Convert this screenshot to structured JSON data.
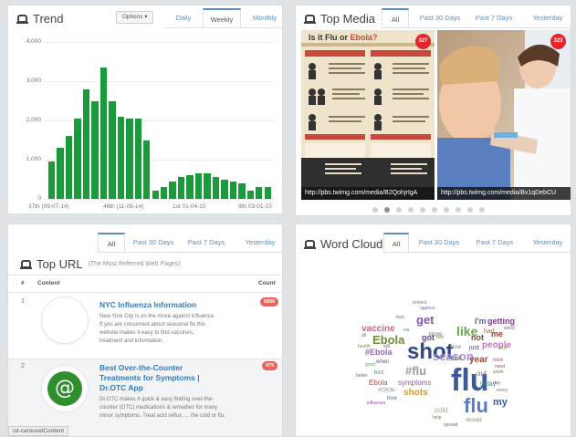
{
  "trend": {
    "title": "Trend",
    "options_label": "Options ▾",
    "tabs": [
      "Daily",
      "Weekly",
      "Monthly"
    ],
    "active_tab": "Weekly",
    "chart_data": {
      "type": "bar",
      "ylim": [
        0,
        4000
      ],
      "yticks": [
        "4,000",
        "3,000",
        "2,000",
        "1,000",
        "0"
      ],
      "xticks": [
        "37th (09-07-14)",
        "46th (11-09-14)",
        "1st 01-04-15",
        "9th 03-01-15"
      ],
      "values": [
        950,
        1300,
        1600,
        2050,
        2800,
        2500,
        3350,
        2500,
        2100,
        2050,
        2050,
        1500,
        200,
        300,
        450,
        550,
        600,
        650,
        650,
        550,
        500,
        450,
        400,
        200,
        300,
        300
      ],
      "color": "#1a9a3a"
    }
  },
  "top_media": {
    "title": "Top Media",
    "tabs": [
      "All",
      "Past 30 Days",
      "Past 7 Days",
      "Yesterday"
    ],
    "active_tab": "All",
    "items": [
      {
        "caption": "http://pbs.twimg.com/media/B2QohjrIgA",
        "count": "327",
        "headline_a": "Is it Flu or ",
        "headline_b": "Ebola?"
      },
      {
        "caption": "http://pbs.twimg.com/media/Bx1qDebCU",
        "count": "323"
      }
    ],
    "dots": 10,
    "active_dot": 1
  },
  "top_url": {
    "title": "Top URL",
    "subtitle": "(The Most Referred Web Pages)",
    "tabs": [
      "All",
      "Past 30 Days",
      "Past 7 Days",
      "Yesterday"
    ],
    "active_tab": "All",
    "columns": [
      "#",
      "Content",
      "Count"
    ],
    "rows": [
      {
        "num": "1",
        "title": "NYC Influenza Information",
        "desc": "New York City is on the move against influenza. If you are concerned about seasonal flu this website makes it easy to find vaccines, treatment and information.",
        "count": "5856",
        "logo": "",
        "logo_color": "#ffffff"
      },
      {
        "num": "2",
        "title": "Best Over-the-Counter Treatments for Symptoms | Dr.OTC App",
        "desc": "Dr.OTC makes it quick & easy finding over-the-counter (OTC) medications & remedies for many minor symptoms. Treat acid reflux, ... the cold or flu.",
        "count": "979",
        "logo": "@",
        "logo_color": "#2f8f2f"
      }
    ],
    "status_text": "ist-carouselContent"
  },
  "word_cloud": {
    "title": "Word Cloud",
    "tabs": [
      "All",
      "Past 30 Days",
      "Past 7 Days",
      "Yesterday"
    ],
    "active_tab": "All",
    "words": [
      {
        "text": "flu",
        "size": 34,
        "color": "#3b5a9a"
      },
      {
        "text": "shot",
        "size": 24,
        "color": "#2e4a86"
      },
      {
        "text": "flu",
        "size": 22,
        "color": "#5a7cc0"
      },
      {
        "text": "like",
        "size": 14,
        "color": "#6aa84f"
      },
      {
        "text": "season",
        "size": 13,
        "color": "#a98bd6"
      },
      {
        "text": "Ebola",
        "size": 13,
        "color": "#6f8a3a"
      },
      {
        "text": "#flu",
        "size": 13,
        "color": "#9b9b9b"
      },
      {
        "text": "get",
        "size": 13,
        "color": "#7a5ab0"
      },
      {
        "text": "vaccine",
        "size": 10,
        "color": "#c06a8a"
      },
      {
        "text": "shots",
        "size": 10,
        "color": "#c79a3e"
      },
      {
        "text": "people",
        "size": 10,
        "color": "#c07ab8"
      },
      {
        "text": "my",
        "size": 11,
        "color": "#3b5a9a"
      },
      {
        "text": "year",
        "size": 10,
        "color": "#9a4a3a"
      },
      {
        "text": "#Ebola",
        "size": 9,
        "color": "#8a6ab0"
      },
      {
        "text": "symptoms",
        "size": 8,
        "color": "#8a5ab0"
      },
      {
        "text": "got",
        "size": 9,
        "color": "#5a4a8a"
      },
      {
        "text": "getting",
        "size": 9,
        "color": "#7a3a8a"
      },
      {
        "text": "I'm",
        "size": 9,
        "color": "#4a6a9a"
      },
      {
        "text": "me",
        "size": 9,
        "color": "#9a3a3a"
      },
      {
        "text": "not",
        "size": 9,
        "color": "#6a4a3a"
      },
      {
        "text": "out",
        "size": 8,
        "color": "#8a6a3a"
      },
      {
        "text": "today",
        "size": 7,
        "color": "#4a8a6a"
      },
      {
        "text": "Ebola",
        "size": 8,
        "color": "#c04a4a"
      },
      {
        "text": "cold",
        "size": 8,
        "color": "#c79a6e"
      },
      {
        "text": "should",
        "size": 6,
        "color": "#8a8a4a"
      },
      {
        "text": "sick",
        "size": 7,
        "color": "#5a8a5a"
      },
      {
        "text": "know",
        "size": 6,
        "color": "#6a6a9a"
      },
      {
        "text": "had",
        "size": 7,
        "color": "#9a6a4a"
      },
      {
        "text": "just",
        "size": 7,
        "color": "#4a4a8a"
      },
      {
        "text": "time",
        "size": 6,
        "color": "#8a8a8a"
      },
      {
        "text": "when",
        "size": 6,
        "color": "#6a4a8a"
      },
      {
        "text": "bird",
        "size": 6,
        "color": "#4a8a8a"
      },
      {
        "text": "#CDCflu",
        "size": 5,
        "color": "#7a7aa0"
      },
      {
        "text": "health",
        "size": 5,
        "color": "#6a9a4a"
      },
      {
        "text": "new",
        "size": 6,
        "color": "#a05a6a"
      },
      {
        "text": "better",
        "size": 5,
        "color": "#7a6a9a"
      },
      {
        "text": "how",
        "size": 6,
        "color": "#5a6a9a"
      },
      {
        "text": "influenza",
        "size": 5,
        "color": "#9a4a9a"
      },
      {
        "text": "week",
        "size": 5,
        "color": "#8a7a4a"
      },
      {
        "text": "feel",
        "size": 5,
        "color": "#6a8a4a"
      },
      {
        "text": "spread",
        "size": 5,
        "color": "#6a6a6a"
      },
      {
        "text": "text",
        "size": 5,
        "color": "#8a5a5a"
      },
      {
        "text": "day",
        "size": 5,
        "color": "#5a5a9a"
      },
      {
        "text": "best",
        "size": 5,
        "color": "#9a8a5a"
      },
      {
        "text": "worst",
        "size": 5,
        "color": "#7a5a7a"
      },
      {
        "text": "via",
        "size": 5,
        "color": "#5a8a8a"
      },
      {
        "text": "help",
        "size": 5,
        "color": "#7a7a4a"
      },
      {
        "text": "against",
        "size": 5,
        "color": "#8a6a9a"
      },
      {
        "text": "protect",
        "size": 5,
        "color": "#6a7a9a"
      },
      {
        "text": "every",
        "size": 5,
        "color": "#9a6a6a"
      },
      {
        "text": "good",
        "size": 5,
        "color": "#5a9a6a"
      },
      {
        "text": "need",
        "size": 5,
        "color": "#7a5a4a"
      },
      {
        "text": "still",
        "size": 5,
        "color": "#6a6a8a"
      },
      {
        "text": "all",
        "size": 5,
        "color": "#8a5a8a"
      }
    ]
  }
}
